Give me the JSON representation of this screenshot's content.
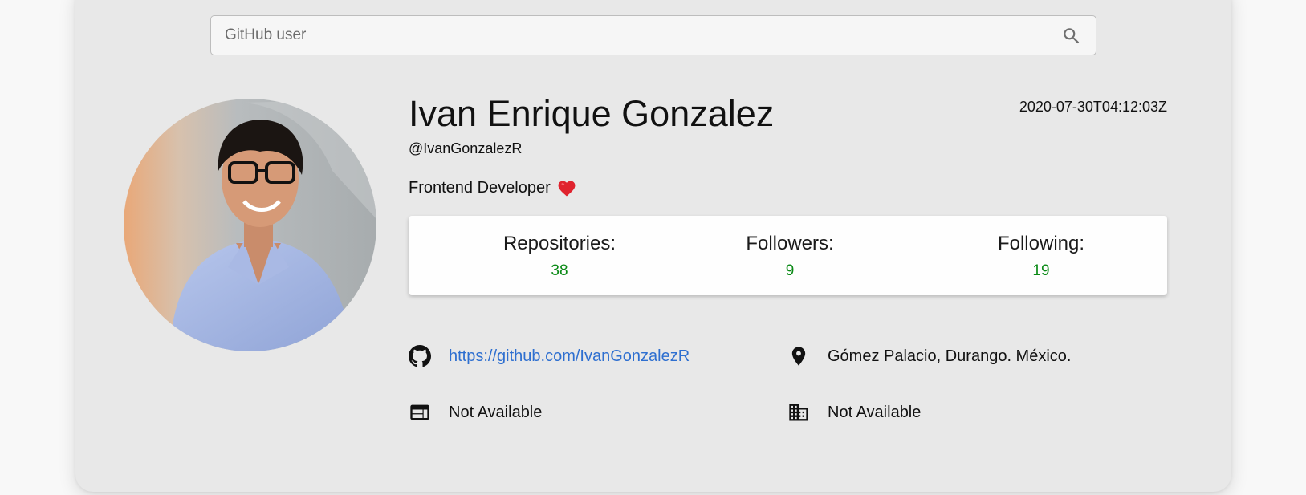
{
  "search": {
    "placeholder": "GitHub user",
    "value": ""
  },
  "profile": {
    "name": "Ivan Enrique Gonzalez",
    "username": "@IvanGonzalezR",
    "created_at": "2020-07-30T04:12:03Z",
    "bio": "Frontend Developer"
  },
  "stats": [
    {
      "label": "Repositories:",
      "value": "38"
    },
    {
      "label": "Followers:",
      "value": "9"
    },
    {
      "label": "Following:",
      "value": "19"
    }
  ],
  "info": {
    "github_url": "https://github.com/IvanGonzalezR",
    "location": "Gómez Palacio, Durango. México.",
    "blog": "Not Available",
    "company": "Not Available"
  },
  "icons": {
    "search": "search-icon",
    "heart": "heart-icon",
    "github": "github-icon",
    "location": "location-pin-icon",
    "blog": "web-icon",
    "company": "building-icon"
  },
  "colors": {
    "stat_value": "#0b8a16",
    "link": "#2e6fd0",
    "card_background": "#e8e8e8",
    "heart": "#e0232e"
  }
}
